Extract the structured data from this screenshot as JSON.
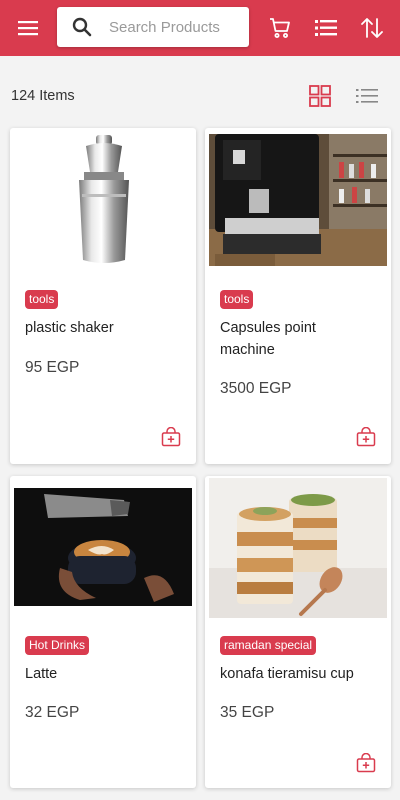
{
  "search": {
    "placeholder": "Search Products"
  },
  "header": {
    "menu_icon": "hamburger-menu-icon",
    "cart_icon": "shopping-cart-icon",
    "list_icon": "list-icon",
    "sort_icon": "sort-icon"
  },
  "listing": {
    "count": "124 Items",
    "grid_view_icon": "grid-view-icon",
    "list_view_icon": "list-view-icon"
  },
  "products": [
    {
      "tag": "tools",
      "name": "plastic shaker",
      "price": "95 EGP"
    },
    {
      "tag": "tools",
      "name": "Capsules point machine",
      "price": "3500 EGP"
    },
    {
      "tag": "Hot Drinks",
      "name": "Latte",
      "price": "32 EGP"
    },
    {
      "tag": "ramadan special",
      "name": "konafa tieramisu cup",
      "price": "35 EGP"
    }
  ],
  "colors": {
    "primary": "#d93b4e",
    "background": "#f3f3f3",
    "card": "#ffffff"
  }
}
